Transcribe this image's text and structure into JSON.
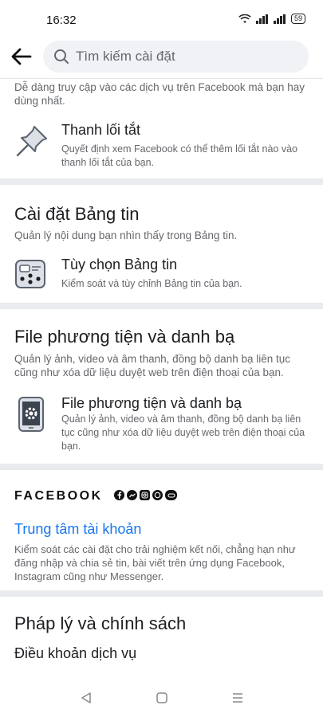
{
  "status": {
    "time": "16:32",
    "battery": "59"
  },
  "header": {
    "search_placeholder": "Tìm kiếm cài đặt"
  },
  "shortcuts": {
    "intro": "Dễ dàng truy cập vào các dịch vụ trên Facebook mà bạn hay dùng nhất.",
    "item_title": "Thanh lối tắt",
    "item_desc": "Quyết định xem Facebook có thể thêm lối tắt nào vào thanh lối tắt của bạn."
  },
  "feed": {
    "title": "Cài đặt Bảng tin",
    "desc": "Quản lý nội dung bạn nhìn thấy trong Bảng tin.",
    "item_title": "Tùy chọn Bảng tin",
    "item_desc": "Kiểm soát và tùy chỉnh Bảng tin của bạn."
  },
  "media": {
    "title": "File phương tiện và danh bạ",
    "desc": "Quản lý ảnh, video và âm thanh, đồng bộ danh bạ liên tục cũng như xóa dữ liệu duyệt web trên điện thoại của bạn.",
    "item_title": "File phương tiện và danh bạ",
    "item_desc": "Quản lý ảnh, video và âm thanh, đồng bộ danh bạ liên tục cũng như xóa dữ liệu duyệt web trên điện thoại của bạn."
  },
  "meta": {
    "brand": "FACEBOOK",
    "link": "Trung tâm tài khoản",
    "desc": "Kiểm soát các cài đặt cho trải nghiệm kết nối, chẳng hạn như đăng nhập và chia sẻ tin, bài viết trên ứng dụng Facebook, Instagram cũng như Messenger."
  },
  "legal": {
    "title": "Pháp lý và chính sách",
    "item": "Điều khoản dịch vụ"
  },
  "colors": {
    "accent": "#1877f2",
    "divider": "#e9ebee"
  }
}
